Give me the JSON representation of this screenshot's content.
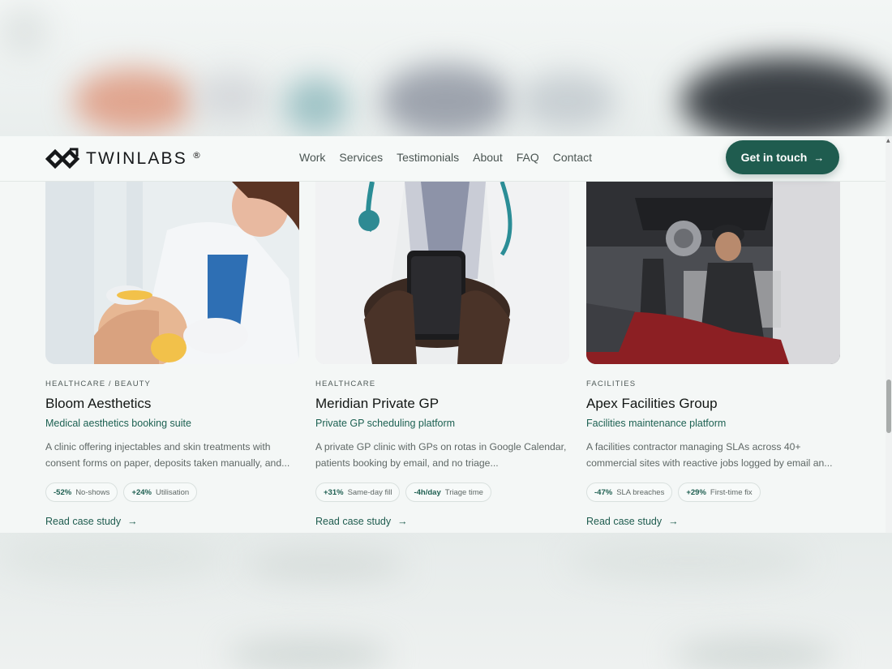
{
  "brand": {
    "name": "TWINLABS",
    "reg": "®"
  },
  "nav": {
    "links": [
      "Work",
      "Services",
      "Testimonials",
      "About",
      "FAQ",
      "Contact"
    ],
    "cta_label": "Get in touch",
    "cta_icon": "arrow-right-icon"
  },
  "colors": {
    "accent": "#1f5c4f",
    "background": "#f4f7f6",
    "text": "#121614"
  },
  "cards": [
    {
      "tag": "HEALTHCARE / BEAUTY",
      "title": "Bloom Aesthetics",
      "subtitle": "Medical aesthetics booking suite",
      "description": "A clinic offering injectables and skin treatments with consent forms on paper, deposits taken manually, and...",
      "metrics": [
        {
          "value": "-52%",
          "label": "No-shows"
        },
        {
          "value": "+24%",
          "label": "Utilisation"
        }
      ],
      "link": "Read case study",
      "image": "aesthetician-treating-client-photo"
    },
    {
      "tag": "HEALTHCARE",
      "title": "Meridian Private GP",
      "subtitle": "Private GP scheduling platform",
      "description": "A private GP clinic with GPs on rotas in Google Calendar, patients booking by email, and no triage...",
      "metrics": [
        {
          "value": "+31%",
          "label": "Same-day fill"
        },
        {
          "value": "-4h/day",
          "label": "Triage time"
        }
      ],
      "link": "Read case study",
      "image": "doctor-holding-phone-photo"
    },
    {
      "tag": "FACILITIES",
      "title": "Apex Facilities Group",
      "subtitle": "Facilities maintenance platform",
      "description": "A facilities contractor managing SLAs across 40+ commercial sites with reactive jobs logged by email an...",
      "metrics": [
        {
          "value": "-47%",
          "label": "SLA breaches"
        },
        {
          "value": "+29%",
          "label": "First-time fix"
        }
      ],
      "link": "Read case study",
      "image": "mechanic-in-garage-photo"
    }
  ]
}
